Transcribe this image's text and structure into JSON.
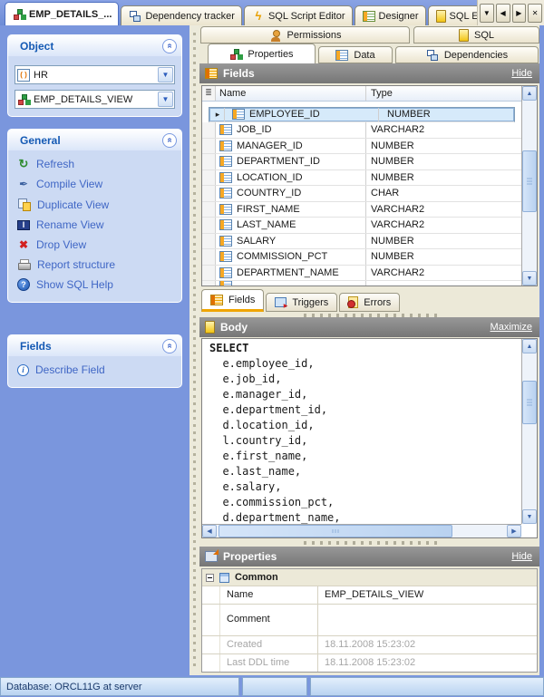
{
  "window_tabs": {
    "tabs": [
      {
        "label": "EMP_DETAILS_..."
      },
      {
        "label": "Dependency tracker"
      },
      {
        "label": "SQL Script Editor"
      },
      {
        "label": "Designer"
      },
      {
        "label": "SQL Editor: ."
      }
    ],
    "nav": {
      "dropdown": "▼",
      "back": "◀",
      "forward": "▶",
      "close": "✕"
    }
  },
  "sidebar": {
    "object_panel": {
      "title": "Object",
      "schema_value": "HR",
      "object_value": "EMP_DETAILS_VIEW"
    },
    "general_panel": {
      "title": "General",
      "items": [
        {
          "label": "Refresh"
        },
        {
          "label": "Compile View"
        },
        {
          "label": "Duplicate View"
        },
        {
          "label": "Rename View"
        },
        {
          "label": "Drop View"
        },
        {
          "label": "Report structure"
        },
        {
          "label": "Show SQL Help"
        }
      ]
    },
    "fields_panel": {
      "title": "Fields",
      "items": [
        {
          "label": "Describe Field"
        }
      ]
    }
  },
  "main": {
    "upper_tabs": [
      {
        "label": "Permissions"
      },
      {
        "label": "SQL"
      }
    ],
    "view_tabs": [
      {
        "label": "Properties"
      },
      {
        "label": "Data"
      },
      {
        "label": "Dependencies"
      }
    ],
    "fields": {
      "title": "Fields",
      "hide_label": "Hide",
      "columns": {
        "name": "Name",
        "type": "Type"
      },
      "rows": [
        {
          "name": "EMPLOYEE_ID",
          "type": "NUMBER"
        },
        {
          "name": "JOB_ID",
          "type": "VARCHAR2"
        },
        {
          "name": "MANAGER_ID",
          "type": "NUMBER"
        },
        {
          "name": "DEPARTMENT_ID",
          "type": "NUMBER"
        },
        {
          "name": "LOCATION_ID",
          "type": "NUMBER"
        },
        {
          "name": "COUNTRY_ID",
          "type": "CHAR"
        },
        {
          "name": "FIRST_NAME",
          "type": "VARCHAR2"
        },
        {
          "name": "LAST_NAME",
          "type": "VARCHAR2"
        },
        {
          "name": "SALARY",
          "type": "NUMBER"
        },
        {
          "name": "COMMISSION_PCT",
          "type": "NUMBER"
        },
        {
          "name": "DEPARTMENT_NAME",
          "type": "VARCHAR2"
        }
      ],
      "tabs": [
        {
          "label": "Fields"
        },
        {
          "label": "Triggers"
        },
        {
          "label": "Errors"
        }
      ]
    },
    "body": {
      "title": "Body",
      "maximize_label": "Maximize",
      "sql_lines": [
        "SELECT",
        "  e.employee_id,",
        "  e.job_id,",
        "  e.manager_id,",
        "  e.department_id,",
        "  d.location_id,",
        "  l.country_id,",
        "  e.first_name,",
        "  e.last_name,",
        "  e.salary,",
        "  e.commission_pct,",
        "  d.department_name,"
      ]
    },
    "properties": {
      "title": "Properties",
      "hide_label": "Hide",
      "group_label": "Common",
      "rows": [
        {
          "label": "Name",
          "value": "EMP_DETAILS_VIEW"
        },
        {
          "label": "Comment",
          "value": ""
        },
        {
          "label": "Created",
          "value": "18.11.2008 15:23:02"
        },
        {
          "label": "Last DDL time",
          "value": "18.11.2008 15:23:02"
        }
      ]
    }
  },
  "status_bar": {
    "text": "Database: ORCL11G at server"
  },
  "colors": {
    "sidebar_blue": "#7a96dd",
    "panel_body_blue": "#ccdaf3",
    "main_bg": "#ece9d8",
    "section_header_gray": "#828282",
    "active_tab_underline_orange": "#f0a500",
    "selected_row_blue": "#d6eafa"
  }
}
